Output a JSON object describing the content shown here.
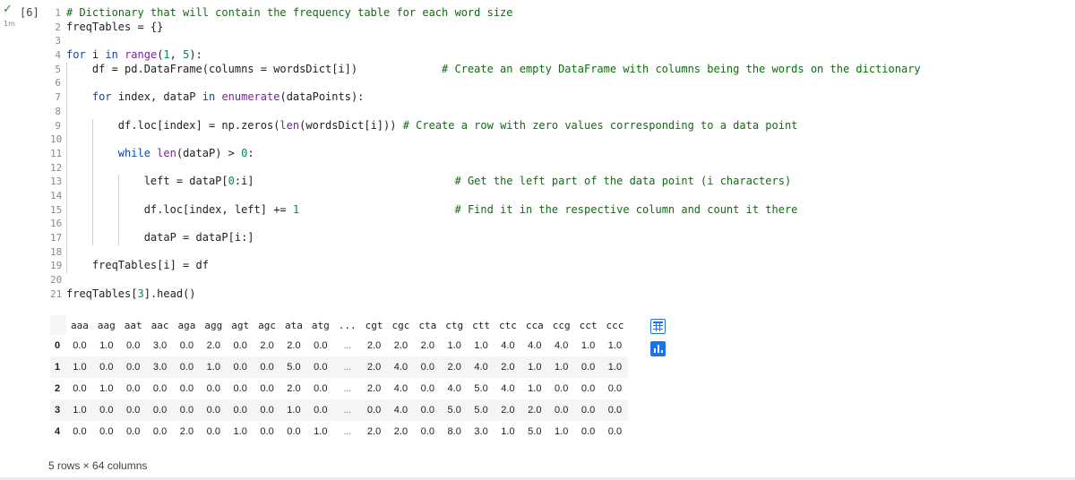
{
  "cell": {
    "execution_count": "[6]",
    "exec_time": "1m",
    "status": "check-icon"
  },
  "code_lines": [
    {
      "n": "1",
      "text": "# Dictionary that will contain the frequency table for each word size"
    },
    {
      "n": "2",
      "text": "freqTables = {}"
    },
    {
      "n": "3",
      "text": ""
    },
    {
      "n": "4",
      "text": "for i in range(1, 5):"
    },
    {
      "n": "5",
      "text": "    df = pd.DataFrame(columns = wordsDict[i])             # Create an empty DataFrame with columns being the words on the dictionary"
    },
    {
      "n": "6",
      "text": ""
    },
    {
      "n": "7",
      "text": "    for index, dataP in enumerate(dataPoints):"
    },
    {
      "n": "8",
      "text": ""
    },
    {
      "n": "9",
      "text": "        df.loc[index] = np.zeros(len(wordsDict[i])) # Create a row with zero values corresponding to a data point"
    },
    {
      "n": "10",
      "text": ""
    },
    {
      "n": "11",
      "text": "        while len(dataP) > 0:"
    },
    {
      "n": "12",
      "text": ""
    },
    {
      "n": "13",
      "text": "            left = dataP[0:i]                               # Get the left part of the data point (i characters)"
    },
    {
      "n": "14",
      "text": ""
    },
    {
      "n": "15",
      "text": "            df.loc[index, left] += 1                        # Find it in the respective column and count it there"
    },
    {
      "n": "16",
      "text": ""
    },
    {
      "n": "17",
      "text": "            dataP = dataP[i:]"
    },
    {
      "n": "18",
      "text": ""
    },
    {
      "n": "19",
      "text": "    freqTables[i] = df"
    },
    {
      "n": "20",
      "text": ""
    },
    {
      "n": "21",
      "text": "freqTables[3].head()"
    }
  ],
  "output": {
    "columns": [
      "aaa",
      "aag",
      "aat",
      "aac",
      "aga",
      "agg",
      "agt",
      "agc",
      "ata",
      "atg",
      "...",
      "cgt",
      "cgc",
      "cta",
      "ctg",
      "ctt",
      "ctc",
      "cca",
      "ccg",
      "cct",
      "ccc"
    ],
    "rows": [
      {
        "index": "0",
        "values": [
          "0.0",
          "1.0",
          "0.0",
          "3.0",
          "0.0",
          "2.0",
          "0.0",
          "2.0",
          "2.0",
          "0.0",
          "...",
          "2.0",
          "2.0",
          "2.0",
          "1.0",
          "1.0",
          "4.0",
          "4.0",
          "4.0",
          "1.0",
          "1.0"
        ]
      },
      {
        "index": "1",
        "values": [
          "1.0",
          "0.0",
          "0.0",
          "3.0",
          "0.0",
          "1.0",
          "0.0",
          "0.0",
          "5.0",
          "0.0",
          "...",
          "2.0",
          "4.0",
          "0.0",
          "2.0",
          "4.0",
          "2.0",
          "1.0",
          "1.0",
          "0.0",
          "1.0"
        ]
      },
      {
        "index": "2",
        "values": [
          "0.0",
          "1.0",
          "0.0",
          "0.0",
          "0.0",
          "0.0",
          "0.0",
          "0.0",
          "2.0",
          "0.0",
          "...",
          "2.0",
          "4.0",
          "0.0",
          "4.0",
          "5.0",
          "4.0",
          "1.0",
          "0.0",
          "0.0",
          "0.0"
        ]
      },
      {
        "index": "3",
        "values": [
          "1.0",
          "0.0",
          "0.0",
          "0.0",
          "0.0",
          "0.0",
          "0.0",
          "0.0",
          "1.0",
          "0.0",
          "...",
          "0.0",
          "4.0",
          "0.0",
          "5.0",
          "5.0",
          "2.0",
          "2.0",
          "0.0",
          "0.0",
          "0.0"
        ]
      },
      {
        "index": "4",
        "values": [
          "0.0",
          "0.0",
          "0.0",
          "0.0",
          "2.0",
          "0.0",
          "1.0",
          "0.0",
          "0.0",
          "1.0",
          "...",
          "2.0",
          "2.0",
          "0.0",
          "8.0",
          "3.0",
          "1.0",
          "5.0",
          "1.0",
          "0.0",
          "0.0"
        ]
      }
    ],
    "shape_text": "5 rows × 64 columns"
  },
  "toolbar": {
    "table_icon": "table-icon",
    "chart_icon": "bar-chart-icon",
    "accent": "#1a73e8"
  }
}
